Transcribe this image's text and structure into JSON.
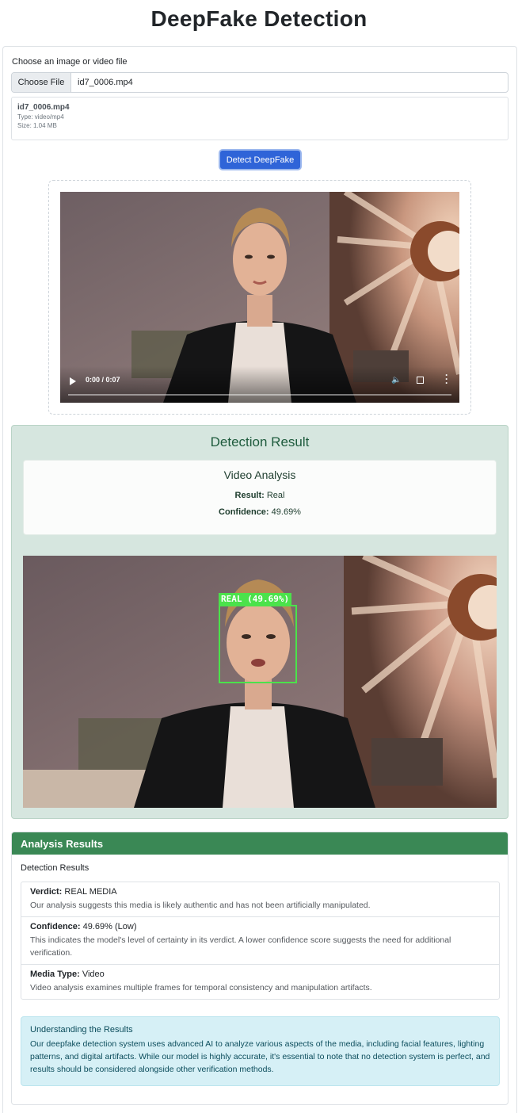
{
  "page": {
    "title": "DeepFake Detection"
  },
  "upload": {
    "label": "Choose an image or video file",
    "button_label": "Choose File",
    "file_name": "id7_0006.mp4",
    "info": {
      "name": "id7_0006.mp4",
      "type": "Type: video/mp4",
      "size": "Size: 1.04 MB"
    },
    "detect_label": "Detect DeepFake"
  },
  "video": {
    "time": "0:00 / 0:07",
    "progress": 0
  },
  "result": {
    "title": "Detection Result",
    "analysis_title": "Video Analysis",
    "result_label": "Result:",
    "result_value": "Real",
    "confidence_label": "Confidence:",
    "confidence_value": "49.69%",
    "face_label": "REAL (49.69%)"
  },
  "analysis": {
    "header": "Analysis Results",
    "section_title": "Detection Results",
    "items": [
      {
        "label": "Verdict:",
        "value": "REAL MEDIA",
        "desc": "Our analysis suggests this media is likely authentic and has not been artificially manipulated."
      },
      {
        "label": "Confidence:",
        "value": "49.69% (Low)",
        "desc": "This indicates the model's level of certainty in its verdict. A lower confidence score suggests the need for additional verification."
      },
      {
        "label": "Media Type:",
        "value": "Video",
        "desc": "Video analysis examines multiple frames for temporal consistency and manipulation artifacts."
      }
    ],
    "info_title": "Understanding the Results",
    "info_text": "Our deepfake detection system uses advanced AI to analyze various aspects of the media, including facial features, lighting patterns, and digital artifacts. While our model is highly accurate, it's essential to note that no detection system is perfect, and results should be considered alongside other verification methods."
  },
  "colors": {
    "primary_button": "#2f64d8",
    "result_bg": "#d6e6df",
    "header_green": "#3a8855",
    "face_box": "#4be24b",
    "info_bg": "#d6f0f6"
  },
  "icons": [
    "play-icon",
    "mute-icon",
    "fullscreen-icon",
    "more-options-icon"
  ]
}
